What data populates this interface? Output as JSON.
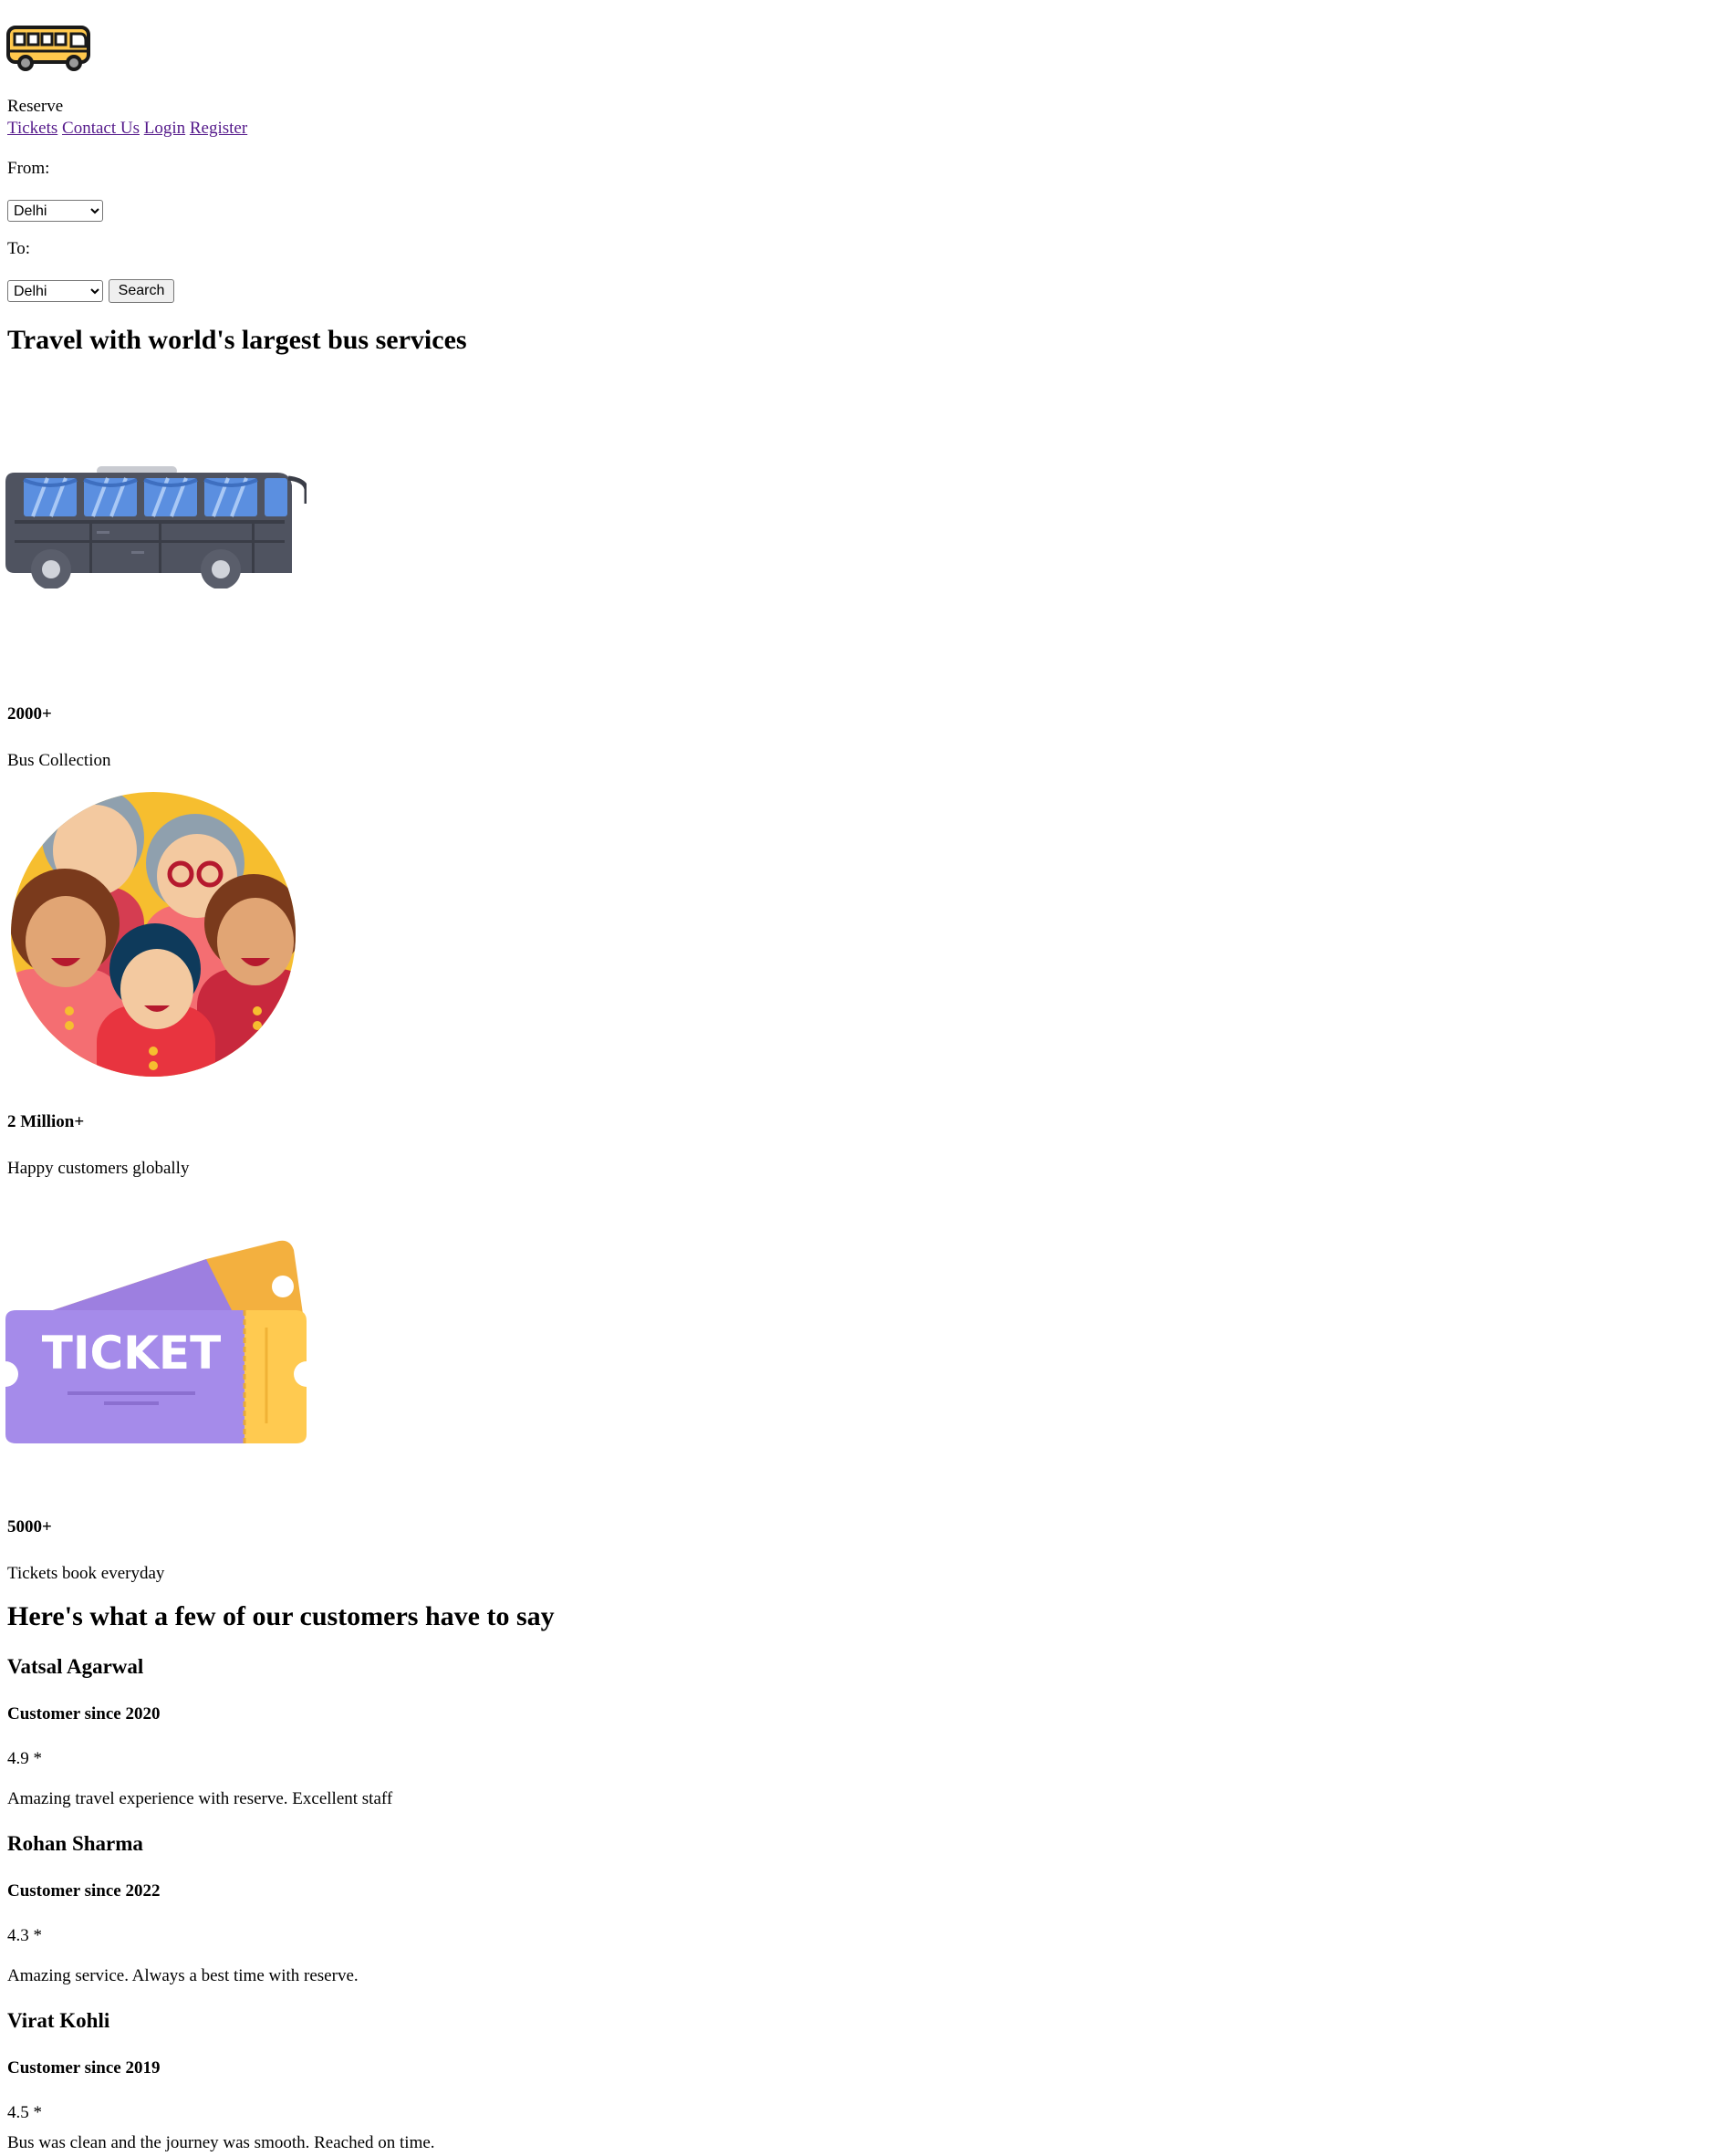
{
  "header": {
    "logo_icon": "bus-logo-icon",
    "brand": "Reserve",
    "nav": [
      "Tickets",
      "Contact Us",
      "Login",
      "Register"
    ]
  },
  "search": {
    "from_label": "From:",
    "from_value": "Delhi",
    "to_label": "To:",
    "to_value": "Delhi",
    "button_label": "Search"
  },
  "hero": {
    "title": "Travel with world's largest bus services"
  },
  "stats": [
    {
      "icon": "bus-icon",
      "value": "2000+",
      "label": "Bus Collection"
    },
    {
      "icon": "customers-group-icon",
      "value": "2 Million+",
      "label": "Happy customers globally"
    },
    {
      "icon": "ticket-icon",
      "value": "5000+",
      "label": "Tickets book everyday",
      "image_text": "TICKET"
    }
  ],
  "testimonials": {
    "title": "Here's what a few of our customers have to say",
    "items": [
      {
        "name": "Vatsal Agarwal",
        "since": "Customer since 2020",
        "rating": "4.9 *",
        "text": "Amazing travel experience with reserve. Excellent staff"
      },
      {
        "name": "Rohan Sharma",
        "since": "Customer since 2022",
        "rating": "4.3 *",
        "text": "Amazing service. Always a best time with reserve."
      },
      {
        "name": "Virat Kohli",
        "since": "Customer since 2019",
        "rating": "4.5 *",
        "text": "Bus was clean and the journey was smooth. Reached on time."
      }
    ]
  },
  "colors": {
    "link": "#551A8B",
    "logo_yellow": "#FFC84D",
    "bus_body": "#4F5360",
    "bus_window": "#5B8FE0",
    "customers_bg": "#F6BE2F",
    "ticket_purple": "#A58BEA",
    "ticket_yellow": "#FFCA50"
  }
}
